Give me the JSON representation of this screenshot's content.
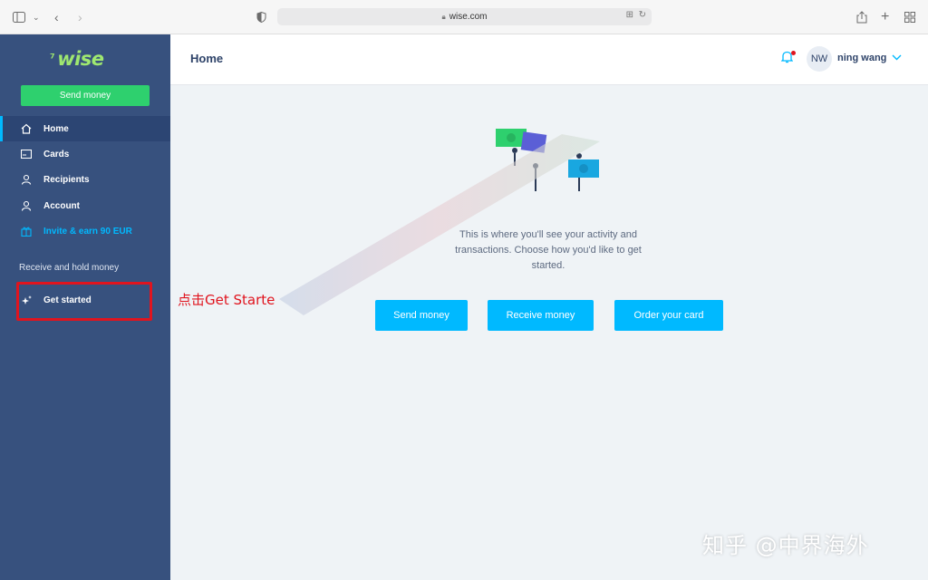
{
  "browser": {
    "url": "wise.com"
  },
  "sidebar": {
    "logo": "wise",
    "send_button": "Send money",
    "items": [
      {
        "label": "Home",
        "icon": "home-icon"
      },
      {
        "label": "Cards",
        "icon": "card-icon"
      },
      {
        "label": "Recipients",
        "icon": "recipients-icon"
      },
      {
        "label": "Account",
        "icon": "account-icon"
      },
      {
        "label": "Invite & earn 90 EUR",
        "icon": "gift-icon"
      }
    ],
    "section_label": "Receive and hold money",
    "get_started": {
      "label": "Get started",
      "icon": "sparkle-icon"
    }
  },
  "header": {
    "title": "Home",
    "avatar_initials": "NW",
    "user_name": "ning wang"
  },
  "main": {
    "empty_message": "This is where you'll see your activity and transactions. Choose how you'd like to get started.",
    "buttons": [
      "Send money",
      "Receive money",
      "Order your card"
    ]
  },
  "overlay": {
    "annotation": "点击Get Starte",
    "watermark": "知乎 @中界海外"
  },
  "colors": {
    "sidebar": "#37517e",
    "accent": "#00b9ff",
    "green": "#2ed06e",
    "annotation": "#e0141e"
  }
}
